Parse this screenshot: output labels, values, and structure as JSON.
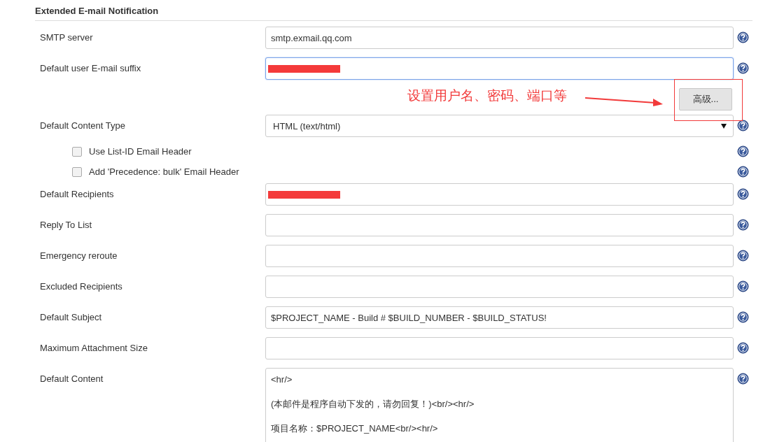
{
  "section": {
    "title": "Extended E-mail Notification"
  },
  "rows": [
    {
      "kind": "text",
      "label": "SMTP server",
      "value": "smtp.exmail.qq.com",
      "focused": false
    },
    {
      "kind": "text",
      "label": "Default user E-mail suffix",
      "focused": true,
      "redacted": true
    },
    {
      "kind": "button",
      "label": "高级..."
    },
    {
      "kind": "select",
      "label": "Default Content Type",
      "value": "HTML (text/html)"
    },
    {
      "kind": "checkbox",
      "label": "Use List-ID Email Header",
      "checked": false
    },
    {
      "kind": "checkbox",
      "label": "Add 'Precedence: bulk' Email Header",
      "checked": false
    },
    {
      "kind": "text",
      "label": "Default Recipients",
      "focused": false,
      "redacted": true
    },
    {
      "kind": "text",
      "label": "Reply To List",
      "focused": false
    },
    {
      "kind": "text",
      "label": "Emergency reroute",
      "focused": false
    },
    {
      "kind": "text",
      "label": "Excluded Recipients",
      "focused": false
    },
    {
      "kind": "text",
      "label": "Default Subject",
      "value": "$PROJECT_NAME - Build # $BUILD_NUMBER - $BUILD_STATUS!",
      "focused": false
    },
    {
      "kind": "text",
      "label": "Maximum Attachment Size",
      "focused": false
    },
    {
      "kind": "textarea",
      "label": "Default Content",
      "lines": [
        "<hr/>",
        "(本邮件是程序自动下发的，请勿回复！)<br/><hr/>",
        "项目名称：$PROJECT_NAME<br/><hr/>"
      ]
    }
  ],
  "annotation": {
    "text": "设置用户名、密码、端口等"
  }
}
